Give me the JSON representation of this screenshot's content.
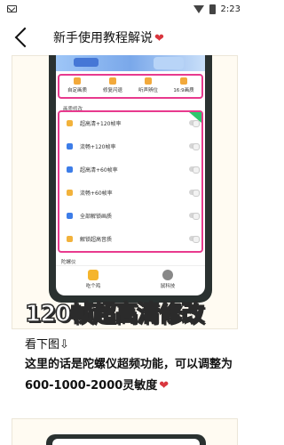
{
  "status": {
    "time": "2:23"
  },
  "header": {
    "title": "新手使用教程解说",
    "title_emoji": "❤"
  },
  "screenshot": {
    "tabs": [
      "自定画质",
      "修复闪退",
      "听声辨位",
      "16:9画质"
    ],
    "section_title": "画质修改",
    "options": [
      "超高清+120帧率",
      "流畅+120帧率",
      "超高清+60帧率",
      "流畅+60帧率",
      "全部解锁画质",
      "解锁超高音质"
    ],
    "bottom_label": "陀螺仪",
    "nav": [
      "吃个鸡",
      "鼠科技"
    ],
    "banner_text": "120帧超高清修改"
  },
  "article": {
    "line1": "看下图⇩",
    "line2": "这里的话是陀螺仪超频功能，可以调整为600-1000-2000灵敏度",
    "line2_emoji": "❤"
  }
}
